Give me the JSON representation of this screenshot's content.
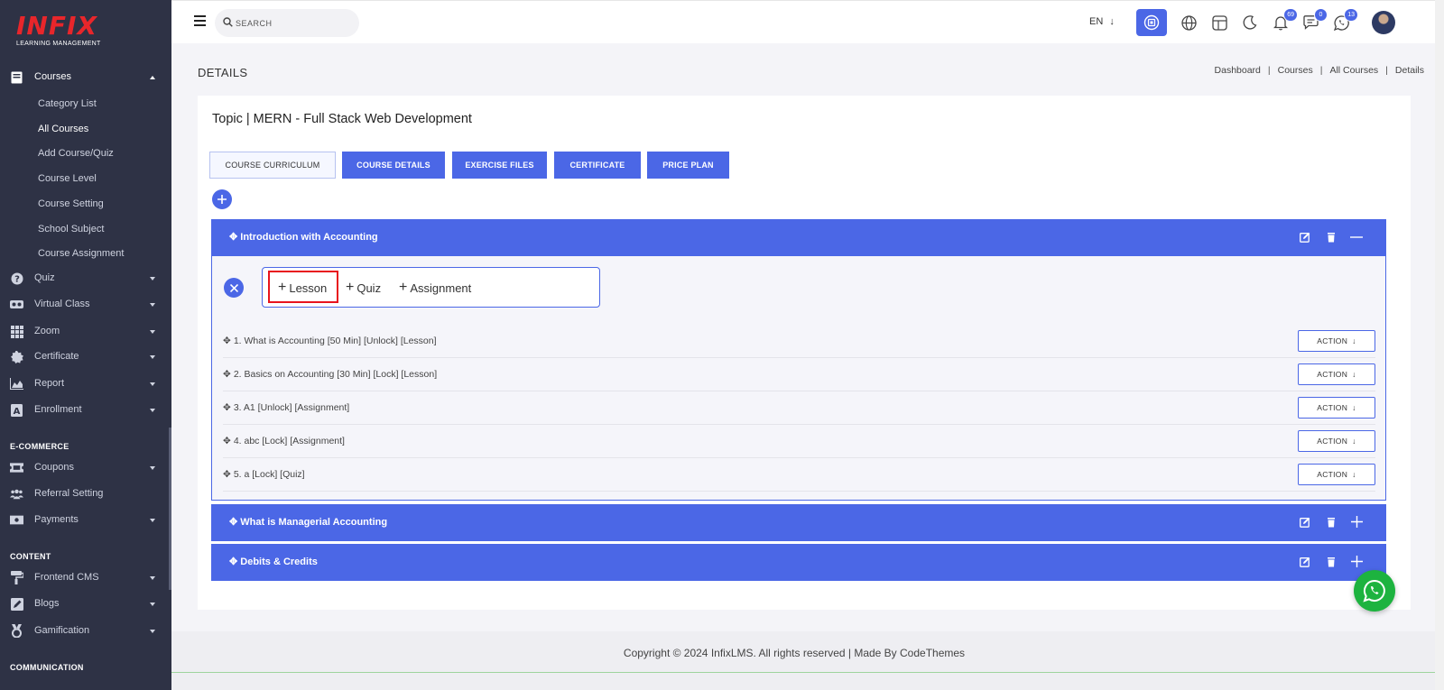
{
  "brand": {
    "logo_text": "INFIX",
    "logo_sub": "LEARNING MANAGEMENT"
  },
  "sidebar": {
    "courses": {
      "label": "Courses",
      "icon": "book-icon",
      "subitems": [
        "Category List",
        "All Courses",
        "Add Course/Quiz",
        "Course Level",
        "Course Setting",
        "School Subject",
        "Course Assignment"
      ],
      "active_subitem": "All Courses"
    },
    "items": [
      {
        "label": "Quiz",
        "icon": "question-circle-icon"
      },
      {
        "label": "Virtual Class",
        "icon": "vr-headset-icon"
      },
      {
        "label": "Zoom",
        "icon": "grid-icon"
      },
      {
        "label": "Certificate",
        "icon": "certificate-icon"
      },
      {
        "label": "Report",
        "icon": "chart-area-icon"
      },
      {
        "label": "Enrollment",
        "icon": "enrollment-icon"
      }
    ],
    "ecommerce_title": "E-COMMERCE",
    "ecommerce_items": [
      {
        "label": "Coupons",
        "icon": "ticket-icon"
      },
      {
        "label": "Referral Setting",
        "icon": "users-icon"
      },
      {
        "label": "Payments",
        "icon": "money-icon"
      }
    ],
    "content_title": "CONTENT",
    "content_items": [
      {
        "label": "Frontend CMS",
        "icon": "paint-roller-icon"
      },
      {
        "label": "Blogs",
        "icon": "edit-icon"
      },
      {
        "label": "Gamification",
        "icon": "medal-icon"
      }
    ],
    "communication_title": "COMMUNICATION"
  },
  "topbar": {
    "search_placeholder": "SEARCH",
    "language": "EN",
    "notifications_count": "69",
    "messages_count": "0",
    "whatsapp_count": "13"
  },
  "page": {
    "title": "DETAILS",
    "breadcrumb": [
      "Dashboard",
      "Courses",
      "All Courses",
      "Details"
    ],
    "topic_title": "Topic | MERN - Full Stack Web Development"
  },
  "tabs": [
    "COURSE CURRICULUM",
    "COURSE DETAILS",
    "EXERCISE FILES",
    "CERTIFICATE",
    "PRICE PLAN"
  ],
  "sections": [
    {
      "title": "Introduction with Accounting",
      "expanded": true
    },
    {
      "title": "What is Managerial Accounting",
      "expanded": false
    },
    {
      "title": "Debits & Credits",
      "expanded": false
    }
  ],
  "add_options": [
    "Lesson",
    "Quiz",
    "Assignment"
  ],
  "lessons": [
    "1. What is Accounting [50 Min] [Unlock] [Lesson]",
    "2. Basics on Accounting [30 Min] [Lock] [Lesson]",
    "3. A1 [Unlock] [Assignment]",
    "4. abc [Lock] [Assignment]",
    "5. a [Lock] [Quiz]"
  ],
  "action_label": "ACTION",
  "footer": "Copyright © 2024 InfixLMS. All rights reserved | Made By CodeThemes",
  "colors": {
    "primary": "#4b67e6",
    "sidebar": "#2e3245",
    "logo_red": "#e8262b",
    "highlight": "#e8141d",
    "whatsapp": "#1db33f"
  }
}
